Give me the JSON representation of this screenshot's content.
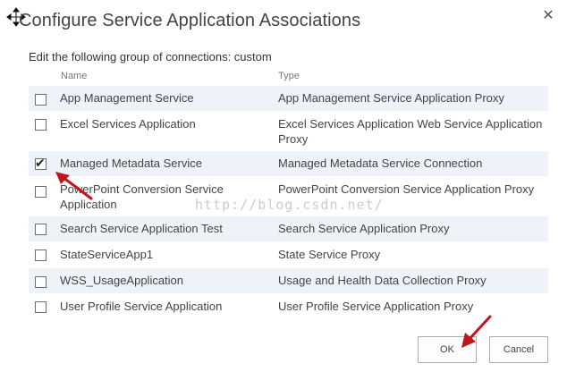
{
  "dialog": {
    "title": "Configure Service Application Associations",
    "close_glyph": "✕",
    "instructions": "Edit the following group of connections: custom",
    "columns": {
      "name": "Name",
      "type": "Type"
    },
    "rows": [
      {
        "name": "App Management Service",
        "type": "App Management Service Application Proxy",
        "checked": false
      },
      {
        "name": "Excel Services Application",
        "type": "Excel Services Application Web Service Application Proxy",
        "checked": false
      },
      {
        "name": "Managed Metadata Service",
        "type": "Managed Metadata Service Connection",
        "checked": true
      },
      {
        "name": "PowerPoint Conversion Service Application",
        "type": "PowerPoint Conversion Service Application Proxy",
        "checked": false
      },
      {
        "name": "Search Service Application Test",
        "type": "Search Service Application Proxy",
        "checked": false
      },
      {
        "name": "StateServiceApp1",
        "type": "State Service Proxy",
        "checked": false
      },
      {
        "name": "WSS_UsageApplication",
        "type": "Usage and Health Data Collection Proxy",
        "checked": false
      },
      {
        "name": "User Profile Service Application",
        "type": "User Profile Service Application Proxy",
        "checked": false
      }
    ],
    "ok_label": "OK",
    "cancel_label": "Cancel"
  },
  "watermark": "http://blog.csdn.net/",
  "colors": {
    "row_alt": "#eef3f9",
    "annotation_arrow": "#c0161e",
    "text": "#444444"
  },
  "icons": {
    "move": "move-icon",
    "close": "close-icon",
    "check": "checkmark-icon"
  }
}
